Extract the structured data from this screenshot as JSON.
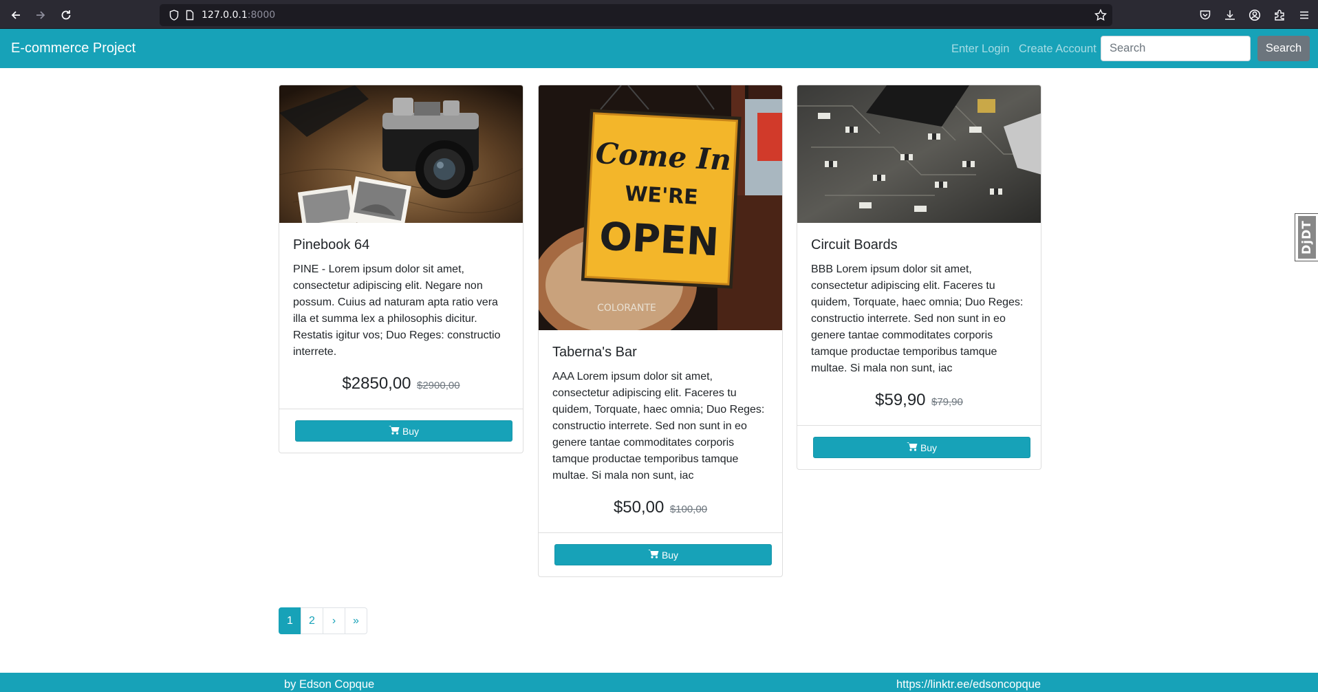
{
  "browser": {
    "url_host": "127.0.0.1",
    "url_port": ":8000"
  },
  "navbar": {
    "brand": "E-commerce Project",
    "login_link": "Enter Login",
    "create_account_link": "Create Account",
    "search_placeholder": "Search",
    "search_button": "Search"
  },
  "products": [
    {
      "title": "Pinebook 64",
      "description": "PINE - Lorem ipsum dolor sit amet, consectetur adipiscing elit. Negare non possum. Cuius ad naturam apta ratio vera illa et summa lex a philosophis dicitur. Restatis igitur vos; Duo Reges: constructio interrete.",
      "price": "$2850,00",
      "old_price": "$2900,00",
      "buy_label": "Buy"
    },
    {
      "title": "Taberna's Bar",
      "description": "AAA Lorem ipsum dolor sit amet, consectetur adipiscing elit. Faceres tu quidem, Torquate, haec omnia; Duo Reges: constructio interrete. Sed non sunt in eo genere tantae commoditates corporis tamque productae temporibus tamque multae. Si mala non sunt, iac",
      "price": "$50,00",
      "old_price": "$100,00",
      "buy_label": "Buy",
      "image_text": {
        "line1": "Come In",
        "line2": "WE'RE",
        "line3": "OPEN",
        "brand": "COLORANTE"
      }
    },
    {
      "title": "Circuit Boards",
      "description": "BBB Lorem ipsum dolor sit amet, consectetur adipiscing elit. Faceres tu quidem, Torquate, haec omnia; Duo Reges: constructio interrete. Sed non sunt in eo genere tantae commoditates corporis tamque productae temporibus tamque multae. Si mala non sunt, iac",
      "price": "$59,90",
      "old_price": "$79,90",
      "buy_label": "Buy"
    }
  ],
  "pagination": {
    "pages": [
      "1",
      "2",
      "›",
      "»"
    ],
    "active": "1"
  },
  "footer": {
    "left": "by Edson Copque",
    "right": "https://linktr.ee/edsoncopque"
  },
  "debug_toolbar": {
    "label": "DjDT"
  },
  "colors": {
    "primary": "#17a2b8",
    "secondary": "#6c757d"
  }
}
